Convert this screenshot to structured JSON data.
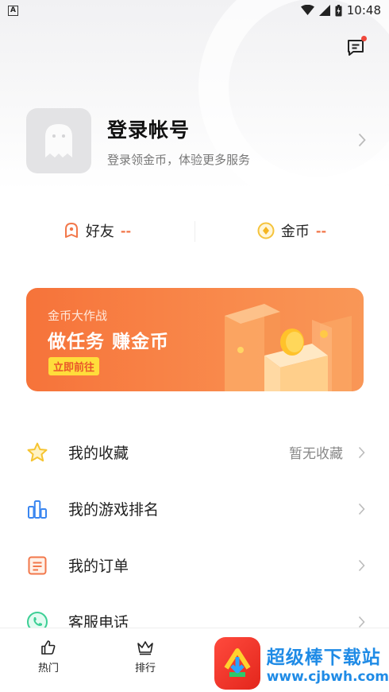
{
  "status_bar": {
    "time": "10:48"
  },
  "profile": {
    "title": "登录帐号",
    "subtitle": "登录领金币，体验更多服务"
  },
  "stats": [
    {
      "label": "好友",
      "value": "--"
    },
    {
      "label": "金币",
      "value": "--"
    }
  ],
  "banner": {
    "small_title": "金币大作战",
    "big_title": "做任务 赚金币",
    "button": "立即前往"
  },
  "menu": [
    {
      "label": "我的收藏",
      "extra": "暂无收藏",
      "icon": "star-icon"
    },
    {
      "label": "我的游戏排名",
      "extra": "",
      "icon": "bar-chart-icon"
    },
    {
      "label": "我的订单",
      "extra": "",
      "icon": "order-icon"
    },
    {
      "label": "客服电话",
      "extra": "",
      "icon": "phone-icon"
    }
  ],
  "bottom_nav": [
    {
      "label": "热门",
      "icon": "thumbs-up-icon"
    },
    {
      "label": "排行",
      "icon": "crown-icon"
    }
  ],
  "watermark": {
    "title": "超级棒下载站",
    "url": "www.cjbwh.com"
  },
  "colors": {
    "accent": "#f2774a",
    "banner": "#f6733a",
    "watermark": "#1f8be6"
  }
}
